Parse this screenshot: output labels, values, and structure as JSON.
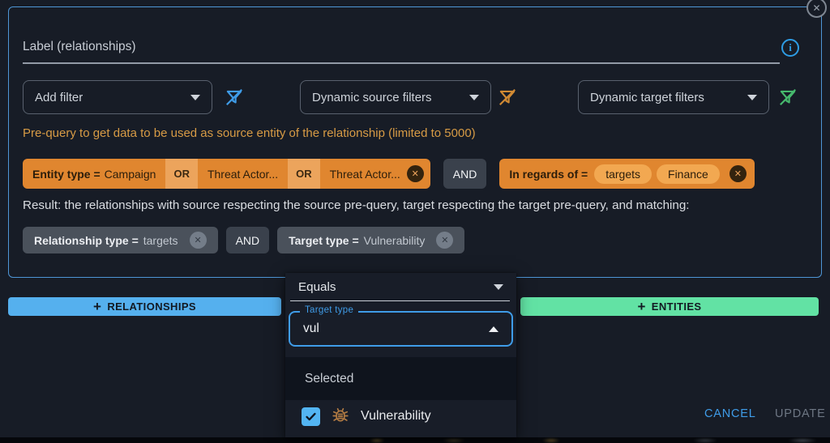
{
  "colors": {
    "accent_blue": "#55b0ee",
    "accent_green": "#62e2a4",
    "accent_orange": "#e0862f",
    "orange_text": "#d79b45",
    "dialog_border": "#4e96d6"
  },
  "icons": {
    "close_glyph": "✕",
    "chip_remove_glyph": "✕",
    "info_glyph": "i",
    "plus_glyph": "+"
  },
  "form": {
    "label_field": {
      "label": "Label (relationships)"
    },
    "add_filter_select": {
      "value": "Add filter"
    },
    "source_filter_select": {
      "value": "Dynamic source filters"
    },
    "target_filter_select": {
      "value": "Dynamic target filters"
    }
  },
  "prequery": {
    "heading": "Pre-query to get data to be used as source entity of the relationship (limited to 5000)",
    "entity_chip": {
      "key": "Entity type =",
      "value": "Campaign",
      "or1": "OR",
      "value2": "Threat Actor...",
      "or2": "OR",
      "value3": "Threat Actor..."
    },
    "and_label": "AND",
    "regards_chip": {
      "key": "In regards of =",
      "pill1": "targets",
      "pill2": "Finance"
    }
  },
  "result": {
    "text": "Result: the relationships with source respecting the source pre-query, target respecting the target pre-query, and matching:",
    "relationship_chip": {
      "key": "Relationship type =",
      "value": "targets"
    },
    "and_label": "AND",
    "target_chip": {
      "key": "Target type =",
      "value": "Vulnerability"
    }
  },
  "actions": {
    "relationships_button": "RELATIONSHIPS",
    "entities_button": "ENTITIES",
    "cancel": "CANCEL",
    "update": "UPDATE"
  },
  "popover": {
    "operator": "Equals",
    "field_label": "Target type",
    "field_value": "vul",
    "selected_header": "Selected",
    "option": {
      "label": "Vulnerability"
    }
  }
}
